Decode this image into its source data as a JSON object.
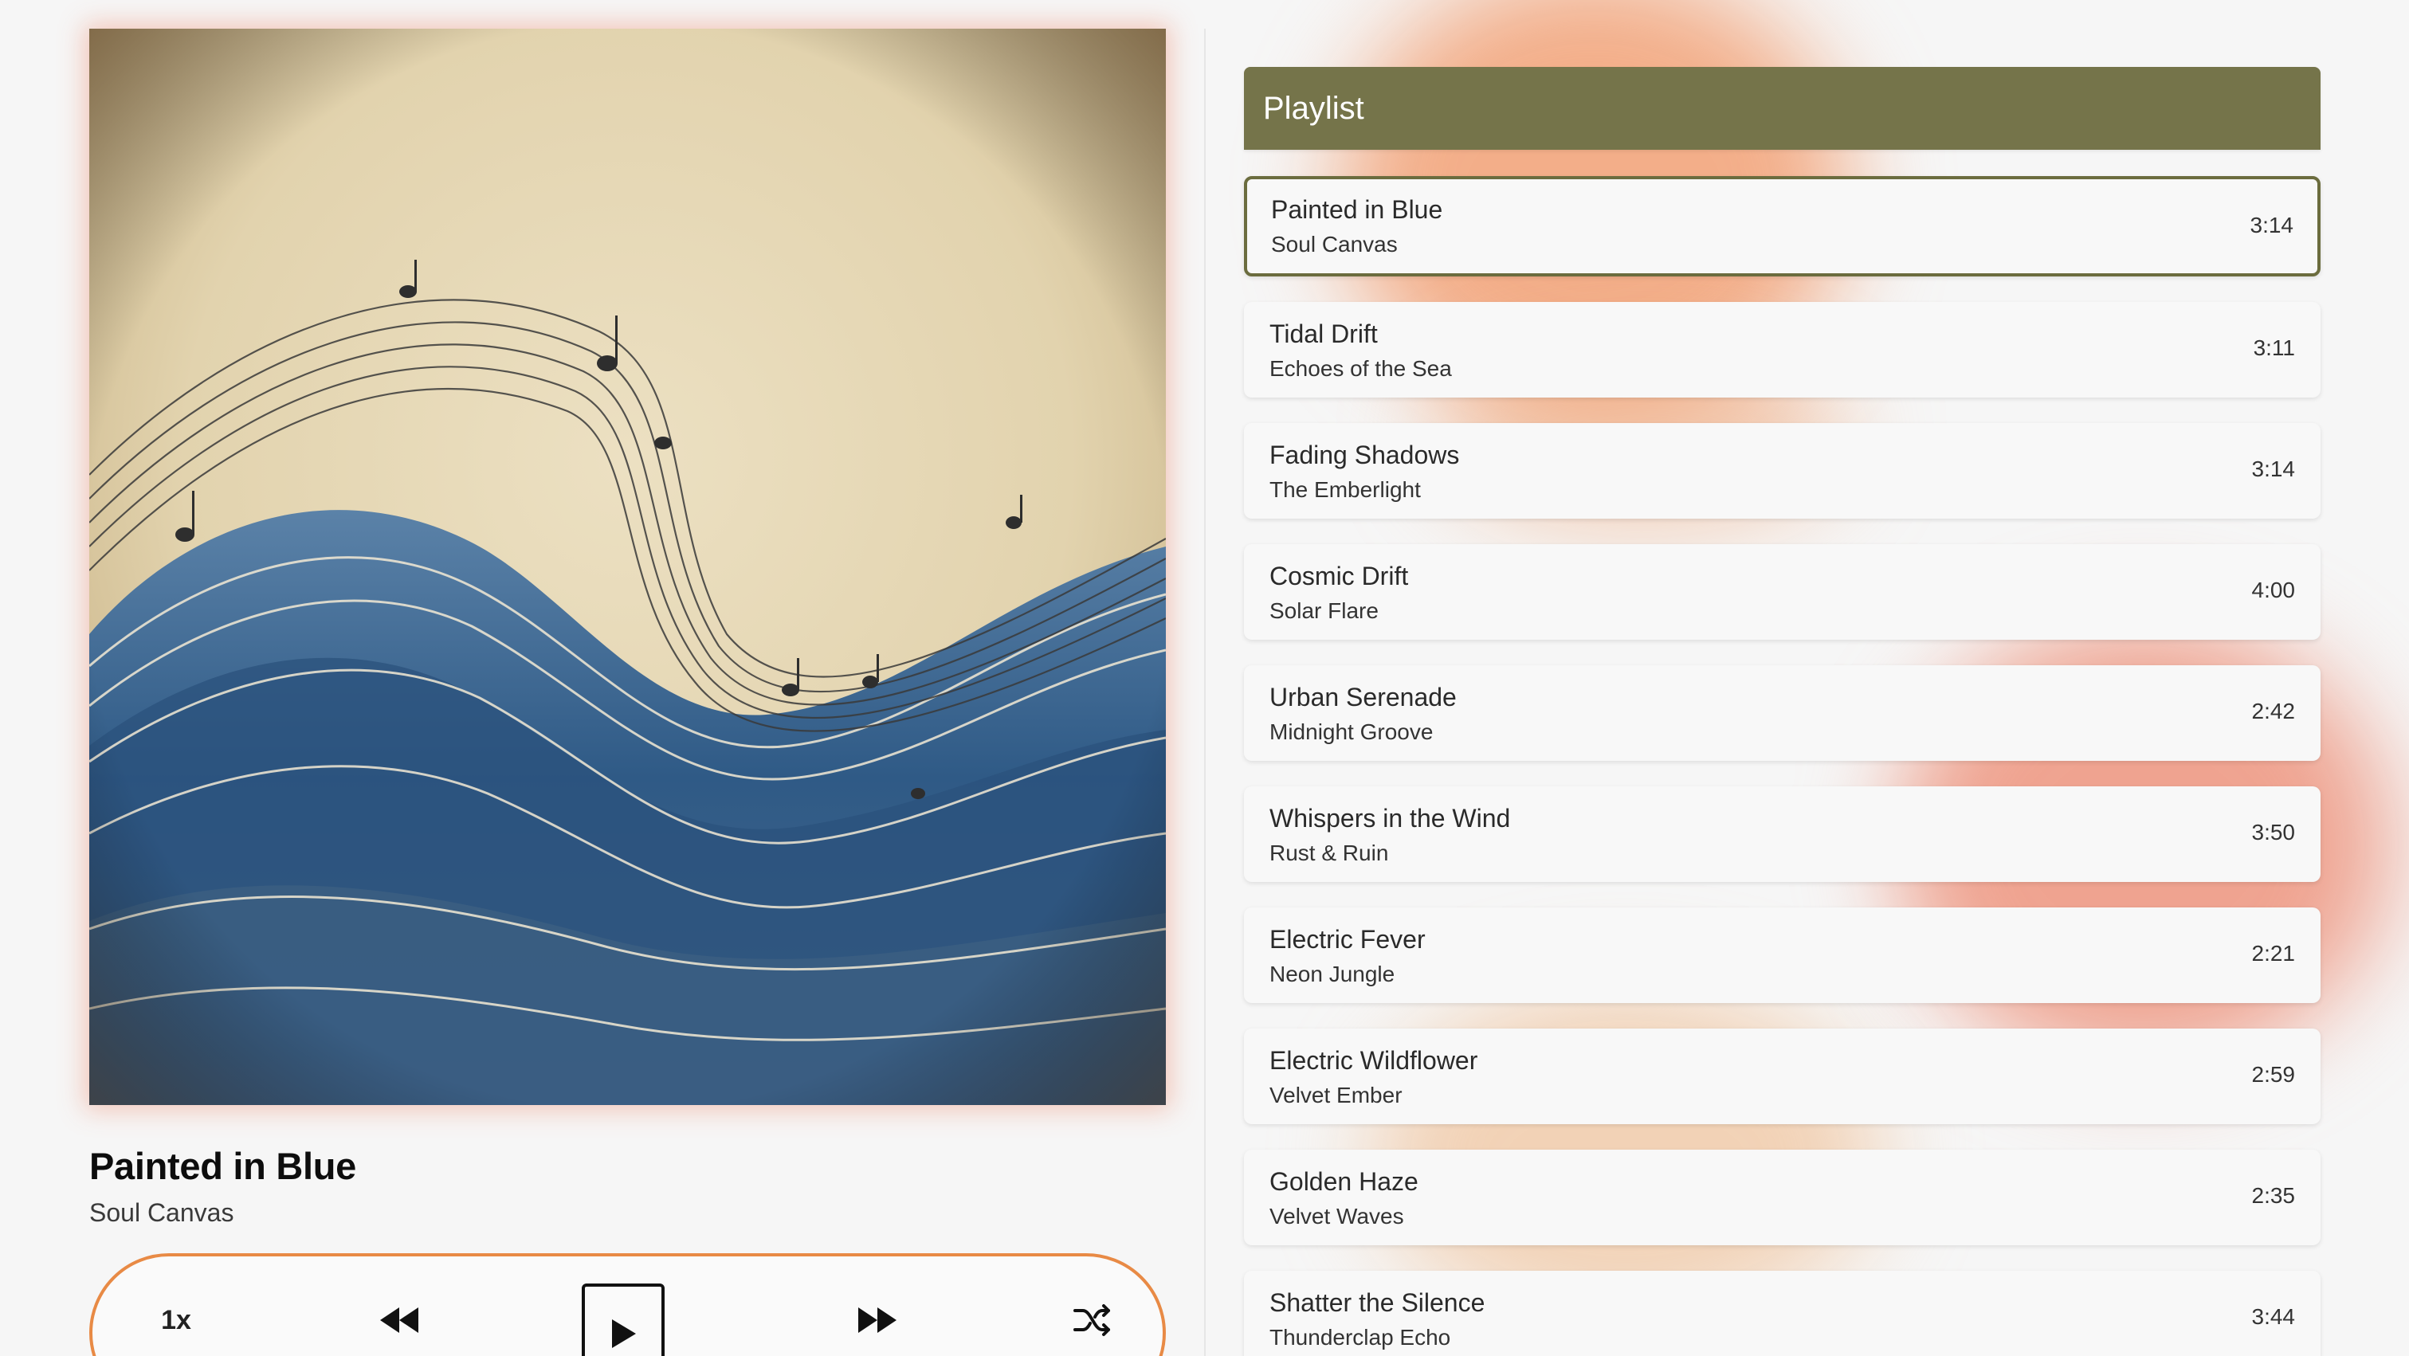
{
  "now_playing": {
    "title": "Painted in Blue",
    "artist": "Soul Canvas",
    "album_art_icon": "wave-sheet-music-artwork"
  },
  "controls": {
    "speed_label": "1x",
    "rewind_icon": "rewind-icon",
    "play_icon": "play-icon",
    "fast_forward_icon": "fast-forward-icon",
    "shuffle_icon": "shuffle-icon"
  },
  "playlist": {
    "header": "Playlist",
    "items": [
      {
        "title": "Painted in Blue",
        "artist": "Soul Canvas",
        "duration": "3:14",
        "active": true
      },
      {
        "title": "Tidal Drift",
        "artist": "Echoes of the Sea",
        "duration": "3:11"
      },
      {
        "title": "Fading Shadows",
        "artist": "The Emberlight",
        "duration": "3:14"
      },
      {
        "title": "Cosmic Drift",
        "artist": "Solar Flare",
        "duration": "4:00"
      },
      {
        "title": "Urban Serenade",
        "artist": "Midnight Groove",
        "duration": "2:42"
      },
      {
        "title": "Whispers in the Wind",
        "artist": "Rust & Ruin",
        "duration": "3:50"
      },
      {
        "title": "Electric Fever",
        "artist": "Neon Jungle",
        "duration": "2:21"
      },
      {
        "title": "Electric Wildflower",
        "artist": "Velvet Ember",
        "duration": "2:59"
      },
      {
        "title": "Golden Haze",
        "artist": "Velvet Waves",
        "duration": "2:35"
      },
      {
        "title": "Shatter the Silence",
        "artist": "Thunderclap Echo",
        "duration": "3:44"
      }
    ]
  },
  "colors": {
    "playlist_header": "#75744a",
    "active_border": "#6b6c3e",
    "controls_border": "#e88a45",
    "glow_orange": "#f0a070",
    "glow_salmon": "#ee9278"
  }
}
